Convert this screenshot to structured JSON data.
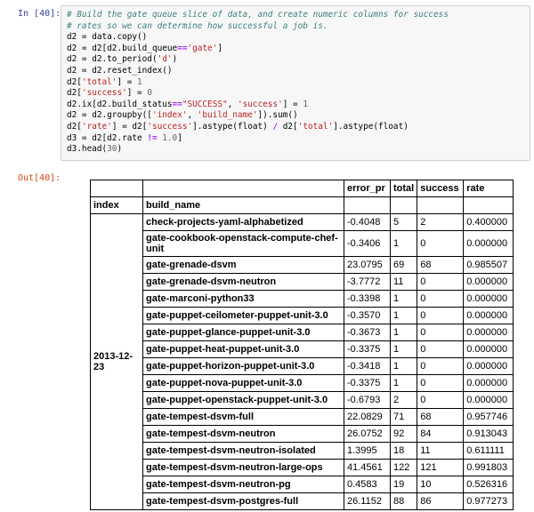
{
  "input_prompt": "In [40]:",
  "output_prompt": "Out[40]:",
  "code": {
    "lines": [
      [
        [
          "c",
          "# Build the gate queue slice of data, and create numeric columns for success"
        ]
      ],
      [
        [
          "c",
          "# rates so we can determine how successful a job is."
        ]
      ],
      [
        [
          "t",
          "d2 = data.copy()"
        ]
      ],
      [
        [
          "t",
          "d2 = d2[d2.build_queue"
        ],
        [
          "o",
          "=="
        ],
        [
          "s",
          "'gate'"
        ],
        [
          "t",
          "]"
        ]
      ],
      [
        [
          "t",
          "d2 = d2.to_period("
        ],
        [
          "s",
          "'d'"
        ],
        [
          "t",
          ")"
        ]
      ],
      [
        [
          "t",
          "d2 = d2.reset_index()"
        ]
      ],
      [
        [
          "t",
          "d2["
        ],
        [
          "s",
          "'total'"
        ],
        [
          "t",
          "] = "
        ],
        [
          "n",
          "1"
        ]
      ],
      [
        [
          "t",
          "d2["
        ],
        [
          "s",
          "'success'"
        ],
        [
          "t",
          "] = "
        ],
        [
          "n",
          "0"
        ]
      ],
      [
        [
          "t",
          "d2.ix[d2.build_status"
        ],
        [
          "o",
          "=="
        ],
        [
          "s",
          "\"SUCCESS\""
        ],
        [
          "t",
          ", "
        ],
        [
          "s",
          "'success'"
        ],
        [
          "t",
          "] = "
        ],
        [
          "n",
          "1"
        ]
      ],
      [
        [
          "t",
          "d2 = d2.groupby(["
        ],
        [
          "s",
          "'index'"
        ],
        [
          "t",
          ", "
        ],
        [
          "s",
          "'build_name'"
        ],
        [
          "t",
          "]).sum()"
        ]
      ],
      [
        [
          "t",
          "d2["
        ],
        [
          "s",
          "'rate'"
        ],
        [
          "t",
          "] = d2["
        ],
        [
          "s",
          "'success'"
        ],
        [
          "t",
          "].astype(float) "
        ],
        [
          "o",
          "/"
        ],
        [
          "t",
          " d2["
        ],
        [
          "s",
          "'total'"
        ],
        [
          "t",
          "].astype(float)"
        ]
      ],
      [
        [
          "t",
          "d3 = d2[d2.rate "
        ],
        [
          "o",
          "!="
        ],
        [
          "t",
          " "
        ],
        [
          "n",
          "1.0"
        ],
        [
          "t",
          "]"
        ]
      ],
      [
        [
          "t",
          "d3.head("
        ],
        [
          "n",
          "30"
        ],
        [
          "t",
          ")"
        ]
      ]
    ]
  },
  "table": {
    "columns": [
      "error_pr",
      "total",
      "success",
      "rate"
    ],
    "index_names": [
      "index",
      "build_name"
    ],
    "date": "2013-12-23",
    "rows": [
      {
        "build": "check-projects-yaml-alphabetized",
        "error_pr": "-0.4048",
        "total": "5",
        "success": "2",
        "rate": "0.400000"
      },
      {
        "build": "gate-cookbook-openstack-compute-chef-unit",
        "error_pr": "-0.3406",
        "total": "1",
        "success": "0",
        "rate": "0.000000"
      },
      {
        "build": "gate-grenade-dsvm",
        "error_pr": "23.0795",
        "total": "69",
        "success": "68",
        "rate": "0.985507"
      },
      {
        "build": "gate-grenade-dsvm-neutron",
        "error_pr": "-3.7772",
        "total": "11",
        "success": "0",
        "rate": "0.000000"
      },
      {
        "build": "gate-marconi-python33",
        "error_pr": "-0.3398",
        "total": "1",
        "success": "0",
        "rate": "0.000000"
      },
      {
        "build": "gate-puppet-ceilometer-puppet-unit-3.0",
        "error_pr": "-0.3570",
        "total": "1",
        "success": "0",
        "rate": "0.000000"
      },
      {
        "build": "gate-puppet-glance-puppet-unit-3.0",
        "error_pr": "-0.3673",
        "total": "1",
        "success": "0",
        "rate": "0.000000"
      },
      {
        "build": "gate-puppet-heat-puppet-unit-3.0",
        "error_pr": "-0.3375",
        "total": "1",
        "success": "0",
        "rate": "0.000000"
      },
      {
        "build": "gate-puppet-horizon-puppet-unit-3.0",
        "error_pr": "-0.3418",
        "total": "1",
        "success": "0",
        "rate": "0.000000"
      },
      {
        "build": "gate-puppet-nova-puppet-unit-3.0",
        "error_pr": "-0.3375",
        "total": "1",
        "success": "0",
        "rate": "0.000000"
      },
      {
        "build": "gate-puppet-openstack-puppet-unit-3.0",
        "error_pr": "-0.6793",
        "total": "2",
        "success": "0",
        "rate": "0.000000"
      },
      {
        "build": "gate-tempest-dsvm-full",
        "error_pr": "22.0829",
        "total": "71",
        "success": "68",
        "rate": "0.957746"
      },
      {
        "build": "gate-tempest-dsvm-neutron",
        "error_pr": "26.0752",
        "total": "92",
        "success": "84",
        "rate": "0.913043"
      },
      {
        "build": "gate-tempest-dsvm-neutron-isolated",
        "error_pr": "1.3995",
        "total": "18",
        "success": "11",
        "rate": "0.611111"
      },
      {
        "build": "gate-tempest-dsvm-neutron-large-ops",
        "error_pr": "41.4561",
        "total": "122",
        "success": "121",
        "rate": "0.991803"
      },
      {
        "build": "gate-tempest-dsvm-neutron-pg",
        "error_pr": "0.4583",
        "total": "19",
        "success": "10",
        "rate": "0.526316"
      },
      {
        "build": "gate-tempest-dsvm-postgres-full",
        "error_pr": "26.1152",
        "total": "88",
        "success": "86",
        "rate": "0.977273"
      }
    ]
  }
}
